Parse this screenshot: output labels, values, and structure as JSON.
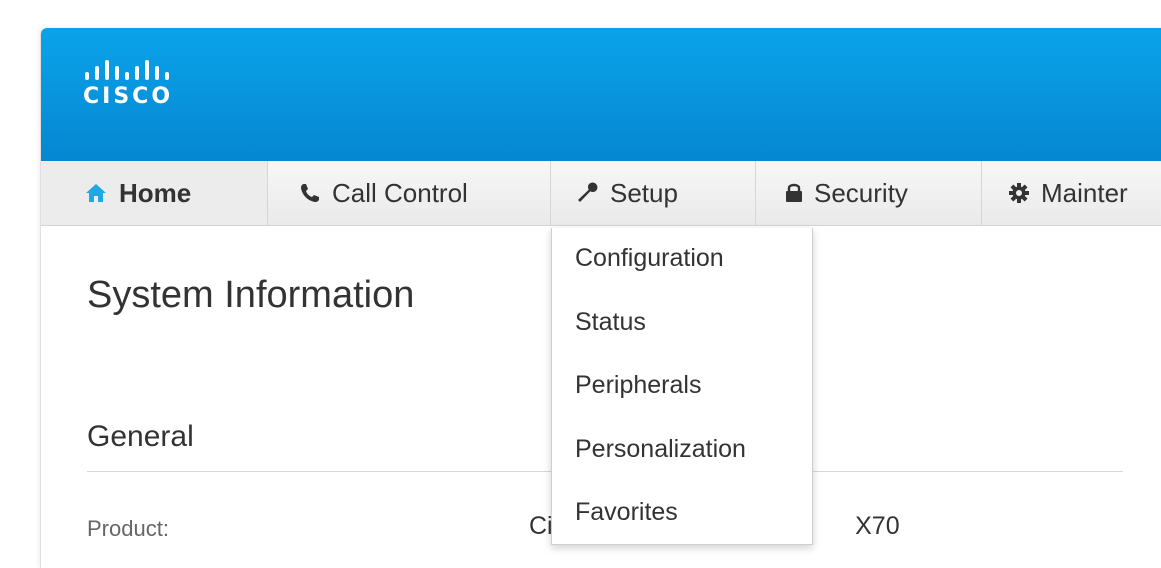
{
  "brand": {
    "logo_text": "CISCO"
  },
  "nav": {
    "tabs": [
      {
        "label": "Home",
        "icon": "home-icon"
      },
      {
        "label": "Call Control",
        "icon": "phone-icon"
      },
      {
        "label": "Setup",
        "icon": "wrench-icon"
      },
      {
        "label": "Security",
        "icon": "lock-icon"
      },
      {
        "label": "Mainter",
        "icon": "gear-icon"
      }
    ]
  },
  "setup_menu": {
    "items": [
      "Configuration",
      "Status",
      "Peripherals",
      "Personalization",
      "Favorites"
    ]
  },
  "main": {
    "title": "System Information",
    "section": "General",
    "rows": [
      {
        "label": "Product:",
        "value_left": "Cis",
        "value_right": "X70"
      }
    ]
  },
  "colors": {
    "header_blue": "#0596dc",
    "home_icon": "#20a7e6",
    "text": "#333333"
  }
}
